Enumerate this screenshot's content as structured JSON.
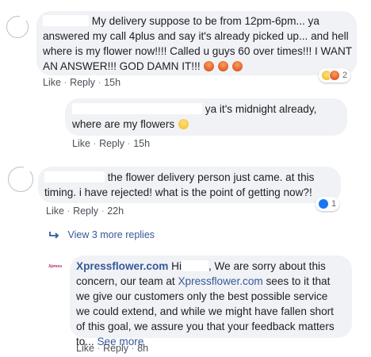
{
  "comments": [
    {
      "lines": [
        "My delivery suppose to be from 12pm-6pm... ya",
        "answered my call 4plus and say it's already picked up... and hell",
        "where is my flower now!!!! Called u guys 60 over times!!! I WANT",
        "AN ANSWER!!! GOD DAMN IT!!!"
      ],
      "like": "Like",
      "reply": "Reply",
      "time": "15h",
      "reaction_count": "2"
    },
    {
      "lines": [
        "ya it's midnight already,",
        "where are my flowers"
      ],
      "like": "Like",
      "reply": "Reply",
      "time": "15h"
    },
    {
      "lines": [
        "the flower delivery person just came. at this",
        "timing. i have rejected! what is the point of getting now?!"
      ],
      "like": "Like",
      "reply": "Reply",
      "time": "22h",
      "reaction_count": "1"
    }
  ],
  "view_replies": "View 3 more replies",
  "page_reply": {
    "author": "Xpressflower.com",
    "greeting": "Hi",
    "line1_rest": ", We are sorry about this",
    "line2_a": "concern, our team at ",
    "line2_link": "Xpressflower.com",
    "line2_b": " sees to it that",
    "lines": [
      "we give our customers only the best possible service",
      "we could extend, and while we might have fallen short",
      "of this goal, we assure you that your feedback matters"
    ],
    "last_prefix": "to...",
    "see_more": "See more",
    "like": "Like",
    "reply": "Reply",
    "time": "8h",
    "avatar_text": "Xpress"
  },
  "colors": {
    "bubble": "#f0f2f5",
    "link": "#365899",
    "meta": "#4b4f56"
  }
}
